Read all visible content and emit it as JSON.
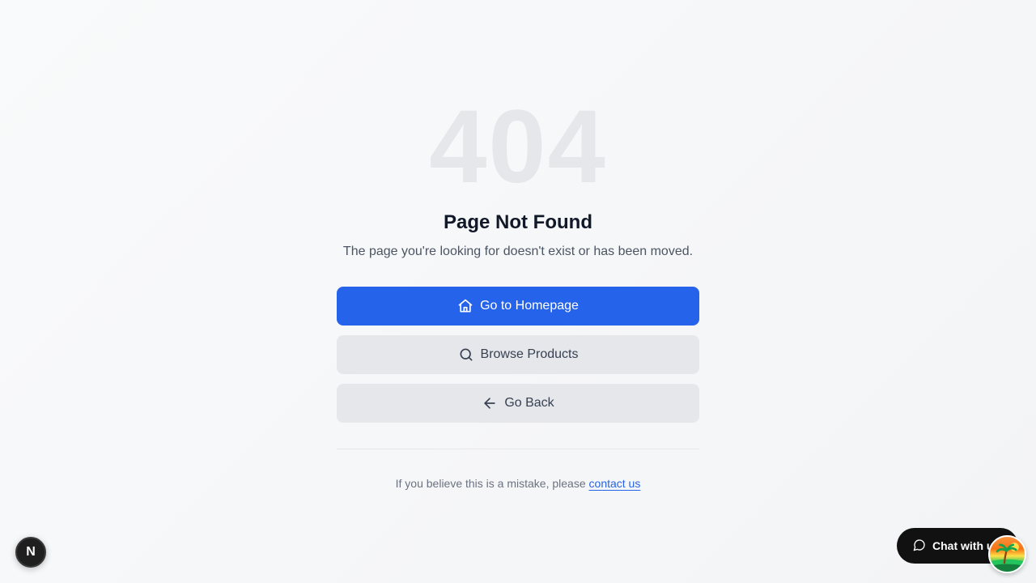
{
  "error": {
    "code": "404",
    "title": "Page Not Found",
    "message": "The page you're looking for doesn't exist or has been moved."
  },
  "actions": {
    "home_label": "Go to Homepage",
    "home_icon": "home-icon",
    "browse_label": "Browse Products",
    "browse_icon": "search-icon",
    "back_label": "Go Back",
    "back_icon": "arrow-left-icon"
  },
  "help": {
    "prefix": "If you believe this is a mistake, please",
    "link_label": "contact us"
  },
  "dev_badge": {
    "label": "N"
  },
  "chat": {
    "label": "Chat with us",
    "icon": "message-circle-icon"
  },
  "colors": {
    "primary": "#2563eb",
    "secondary_button": "#e5e7eb",
    "code_text": "#e5e7eb",
    "title_text": "#111827",
    "body_text": "#4b5563",
    "chat_background": "#111111"
  }
}
